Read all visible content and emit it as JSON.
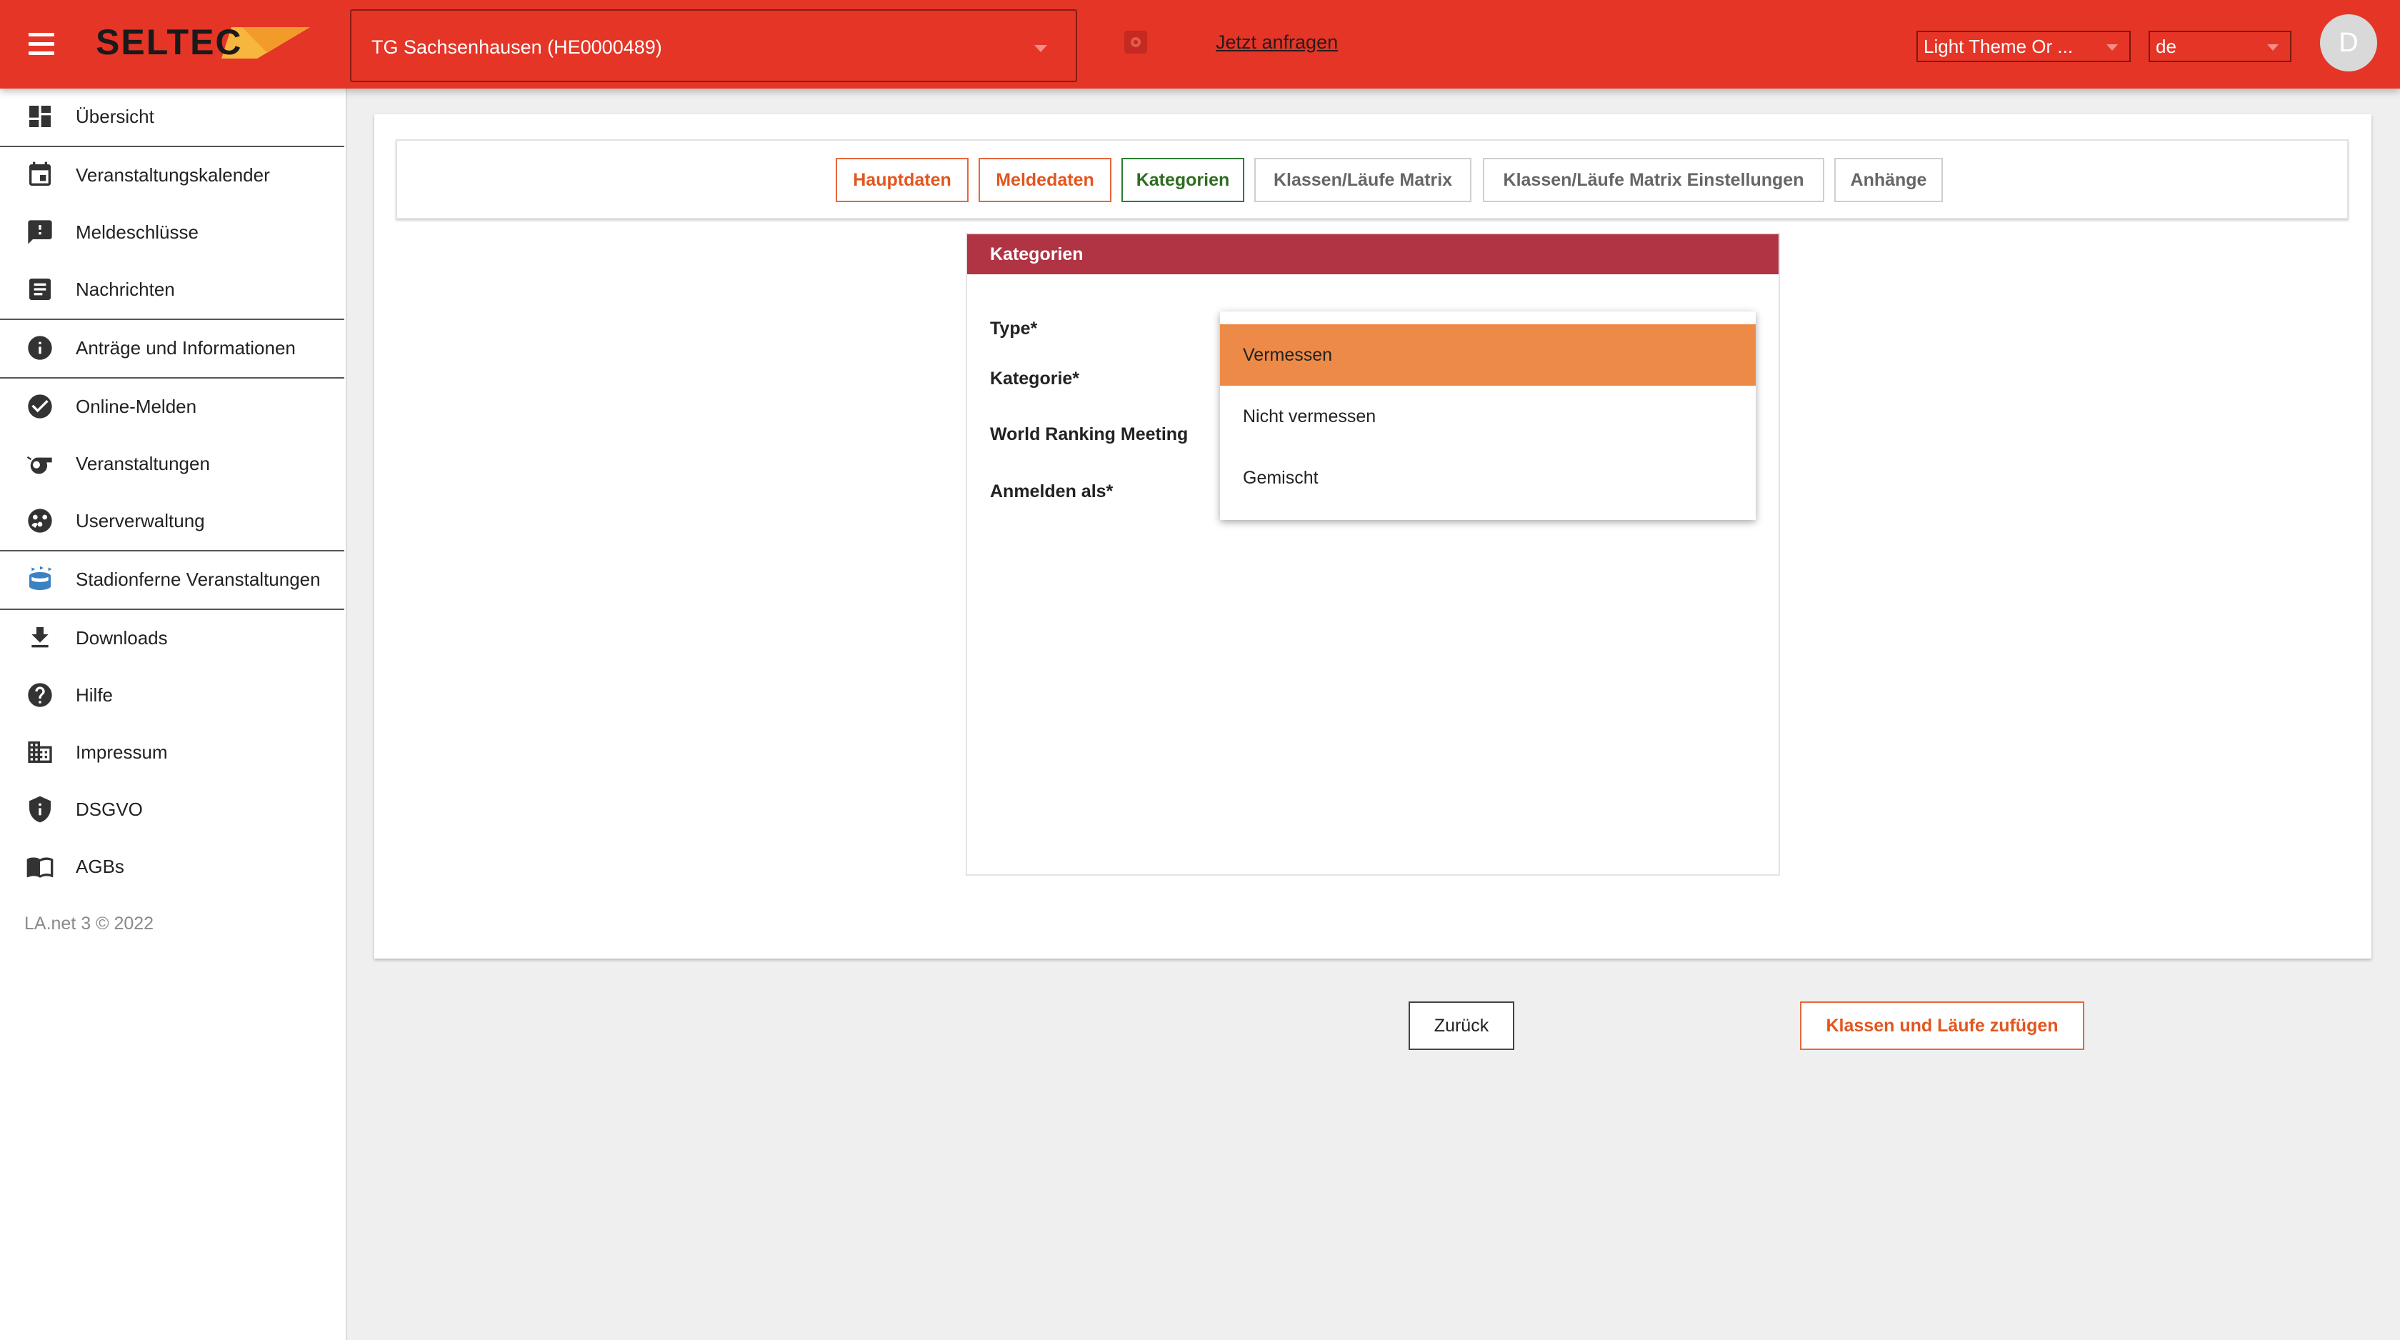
{
  "header": {
    "logo_text": "SELTEC",
    "club_select_value": "TG Sachsenhausen (HE0000489)",
    "request_link": "Jetzt anfragen",
    "theme_select_value": "Light Theme Or ...",
    "language_select_value": "de",
    "avatar_initial": "D"
  },
  "sidebar": {
    "items": [
      {
        "label": "Übersicht",
        "icon": "dashboard-icon"
      },
      {
        "label": "Veranstaltungskalender",
        "icon": "calendar-icon"
      },
      {
        "label": "Meldeschlüsse",
        "icon": "feedback-icon"
      },
      {
        "label": "Nachrichten",
        "icon": "article-icon"
      },
      {
        "label": "Anträge und Informationen",
        "icon": "info-icon"
      },
      {
        "label": "Online-Melden",
        "icon": "check-circle-icon"
      },
      {
        "label": "Veranstaltungen",
        "icon": "whistle-icon"
      },
      {
        "label": "Userverwaltung",
        "icon": "users-icon"
      },
      {
        "label": "Stadionferne Veranstaltungen",
        "icon": "stadium-icon"
      },
      {
        "label": "Downloads",
        "icon": "download-icon"
      },
      {
        "label": "Hilfe",
        "icon": "help-icon"
      },
      {
        "label": "Impressum",
        "icon": "building-icon"
      },
      {
        "label": "DSGVO",
        "icon": "shield-icon"
      },
      {
        "label": "AGBs",
        "icon": "book-icon"
      }
    ],
    "copyright": "LA.net 3 © 2022"
  },
  "tabs": [
    {
      "label": "Hauptdaten",
      "state": "done"
    },
    {
      "label": "Meldedaten",
      "state": "done"
    },
    {
      "label": "Kategorien",
      "state": "active"
    },
    {
      "label": "Klassen/Läufe Matrix",
      "state": "inactive"
    },
    {
      "label": "Klassen/Läufe Matrix Einstellungen",
      "state": "inactive"
    },
    {
      "label": "Anhänge",
      "state": "inactive"
    }
  ],
  "panel": {
    "title": "Kategorien",
    "fields": {
      "type": "Type*",
      "kategorie": "Kategorie*",
      "world_ranking": "World Ranking Meeting",
      "anmelden": "Anmelden als*"
    }
  },
  "type_dropdown": {
    "options": [
      "Vermessen",
      "Nicht vermessen",
      "Gemischt"
    ],
    "highlighted": "Vermessen"
  },
  "buttons": {
    "back": "Zurück",
    "add": "Klassen und Läufe zufügen"
  },
  "colors": {
    "header_bg": "#e53527",
    "panel_header_bg": "#b03443",
    "accent_orange": "#e8663b",
    "dropdown_highlight": "#ee8a47",
    "active_tab_green": "#2e7d32"
  }
}
